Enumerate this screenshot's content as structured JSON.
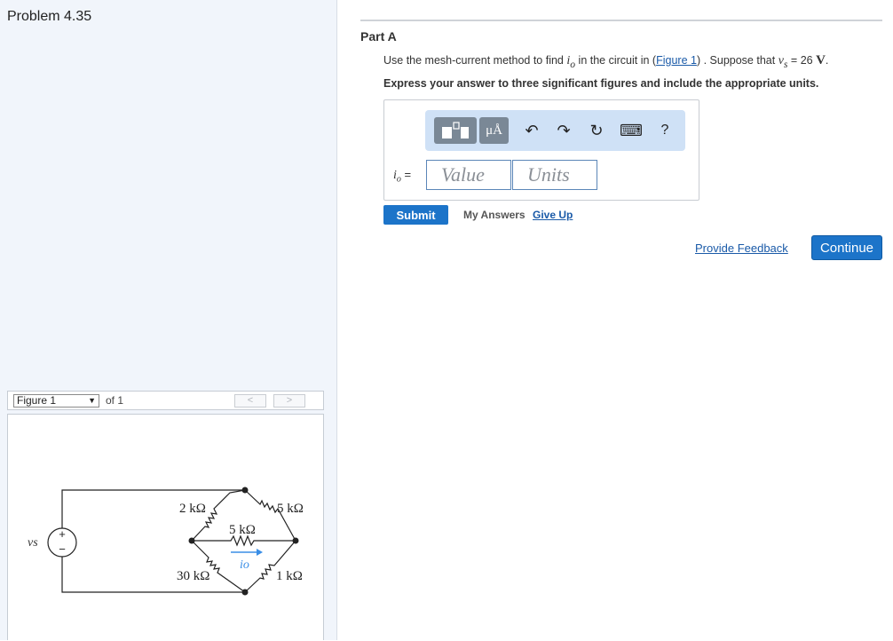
{
  "problem": {
    "title": "Problem 4.35"
  },
  "figure": {
    "selected": "Figure 1",
    "of_label": "of 1",
    "prev": "<",
    "next": ">",
    "labels": {
      "source": "vs",
      "plus": "+",
      "minus": "−",
      "r_top_left": "2 kΩ",
      "r_top_right": "5 kΩ",
      "r_middle": "5 kΩ",
      "r_bottom_left": "30 kΩ",
      "r_bottom_right": "1 kΩ",
      "current": "io"
    },
    "colors": {
      "wire": "#222222",
      "current_arrow": "#3a8ee6"
    }
  },
  "part": {
    "title": "Part A",
    "question_pre": "Use the mesh-current method to find ",
    "question_var": "i",
    "question_var_sub": "o",
    "question_mid": " in the circuit in (",
    "figure_link": "Figure 1",
    "question_post": ") . Suppose that ",
    "vs_var": "v",
    "vs_sub": "s",
    "vs_value": " = 26 ",
    "vs_unit": "V",
    "period": ".",
    "instruction": "Express your answer to three significant figures and include the appropriate units."
  },
  "toolbar": {
    "units_label": "μÅ",
    "undo_icon": "↶",
    "redo_icon": "↷",
    "reset_icon": "↻",
    "keyboard_icon": "⌨",
    "help_label": "?"
  },
  "answer": {
    "label": "i",
    "label_sub": "o",
    "equals": " =",
    "value_placeholder": "Value",
    "units_placeholder": "Units"
  },
  "actions": {
    "submit": "Submit",
    "my_answers": "My Answers",
    "give_up": "Give Up",
    "provide_feedback": "Provide Feedback",
    "continue": "Continue"
  },
  "colors": {
    "accent": "#1c74c9",
    "link": "#1a5aa8",
    "toolbar_bg": "#cfe1f6",
    "left_bg": "#f1f5fb"
  }
}
